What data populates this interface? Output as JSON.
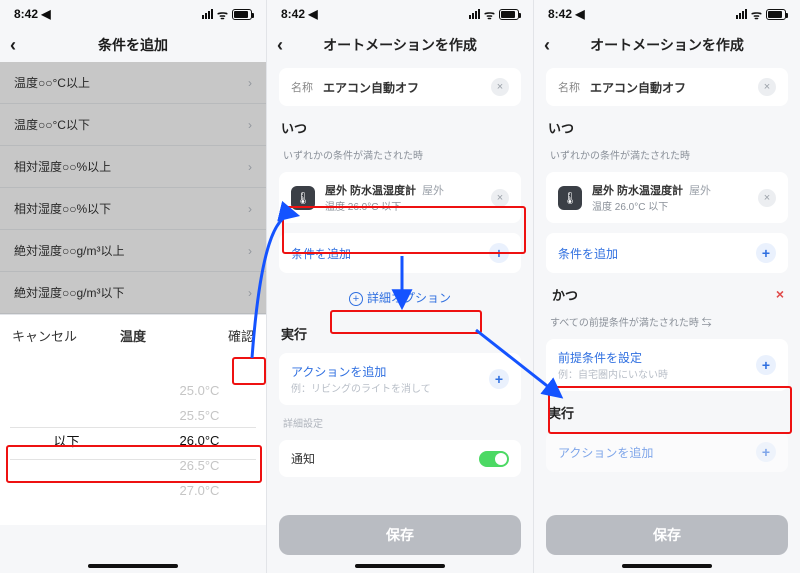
{
  "status": {
    "time": "8:42",
    "arrow": "➤",
    "wifi": "ᯤ",
    "battery": "70"
  },
  "s1": {
    "title": "条件を追加",
    "rows": [
      "温度○○°C以上",
      "温度○○°C以下",
      "相対湿度○○%以上",
      "相対湿度○○%以下",
      "絶対湿度○○g/m³以上",
      "絶対湿度○○g/m³以下"
    ],
    "sheet": {
      "cancel": "キャンセル",
      "title": "温度",
      "confirm": "確認",
      "left": {
        "options": [
          "以下"
        ],
        "selected": "以下"
      },
      "right": {
        "options": [
          "25.0°C",
          "25.5°C",
          "26.0°C",
          "26.5°C",
          "27.0°C"
        ],
        "selected": "26.0°C"
      }
    }
  },
  "s2": {
    "title": "オートメーションを作成",
    "name_label": "名称",
    "name_value": "エアコン自動オフ",
    "when": "いつ",
    "when_sub": "いずれかの条件が満たされた時",
    "cond": {
      "title": "屋外 防水温湿度計",
      "tag": "屋外",
      "sub": "温度 26.0°C 以下"
    },
    "add_cond": "条件を追加",
    "adv": "詳細オプション",
    "exec": "実行",
    "add_action": "アクションを追加",
    "add_action_eg": "例：リビングのライトを消して",
    "detail": "詳細設定",
    "notify": "通知",
    "save": "保存"
  },
  "s3": {
    "title": "オートメーションを作成",
    "name_label": "名称",
    "name_value": "エアコン自動オフ",
    "when": "いつ",
    "when_sub": "いずれかの条件が満たされた時",
    "cond": {
      "title": "屋外 防水温湿度計",
      "tag": "屋外",
      "sub": "温度 26.0°C 以下"
    },
    "add_cond": "条件を追加",
    "and": "かつ",
    "and_sub": "すべての前提条件が満たされた時 ⇆",
    "precond": "前提条件を設定",
    "precond_eg": "例：自宅圏内にいない時",
    "exec": "実行",
    "add_action": "アクションを追加",
    "save": "保存"
  }
}
